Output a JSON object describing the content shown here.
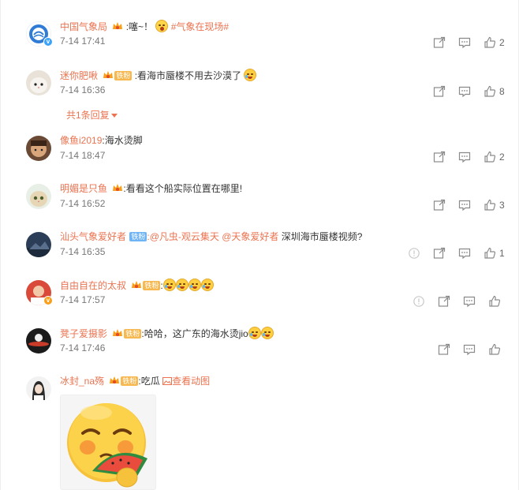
{
  "comments": [
    {
      "user": "中国气象局",
      "badge": "",
      "text": ":噻~！",
      "topic": "#气象在现场#",
      "time": "7-14 17:41",
      "likes": "2"
    },
    {
      "user": "迷你肥啾",
      "badge": "铁粉",
      "text": ":看海市蜃楼不用去沙漠了",
      "time": "7-14 16:36",
      "likes": "8"
    },
    {
      "user": "像鱼i2019",
      "badge": "",
      "text": ":海水烫脚",
      "time": "7-14 18:47",
      "likes": "2"
    },
    {
      "user": "明媚是只鱼",
      "badge": "",
      "text": ":看看这个船实际位置在哪里!",
      "time": "7-14 16:52",
      "likes": "3"
    },
    {
      "user": "汕头气象爱好者",
      "badge": "铁粉",
      "mention1": ":@凡虫-观云集天",
      "mention2": "@天象爱好者",
      "text": " 深圳海市蜃楼视频?",
      "time": "7-14 16:35",
      "likes": "1"
    },
    {
      "user": "自由自在的太叔",
      "badge": "铁粉",
      "text": ":",
      "time": "7-14 17:57",
      "likes": ""
    },
    {
      "user": "凳子爱摄影",
      "badge": "铁粉",
      "text": ":哈哈，这广东的海水烫jio",
      "time": "7-14 17:46",
      "likes": ""
    },
    {
      "user": "冰封_na殇",
      "badge": "铁粉",
      "text": ":吃瓜",
      "view_gif": "查看动图"
    }
  ],
  "reply_toggle": "共1条回复",
  "colors": {
    "accent": "#eb7350",
    "muted": "#777777",
    "icon": "#8a8a8a"
  }
}
